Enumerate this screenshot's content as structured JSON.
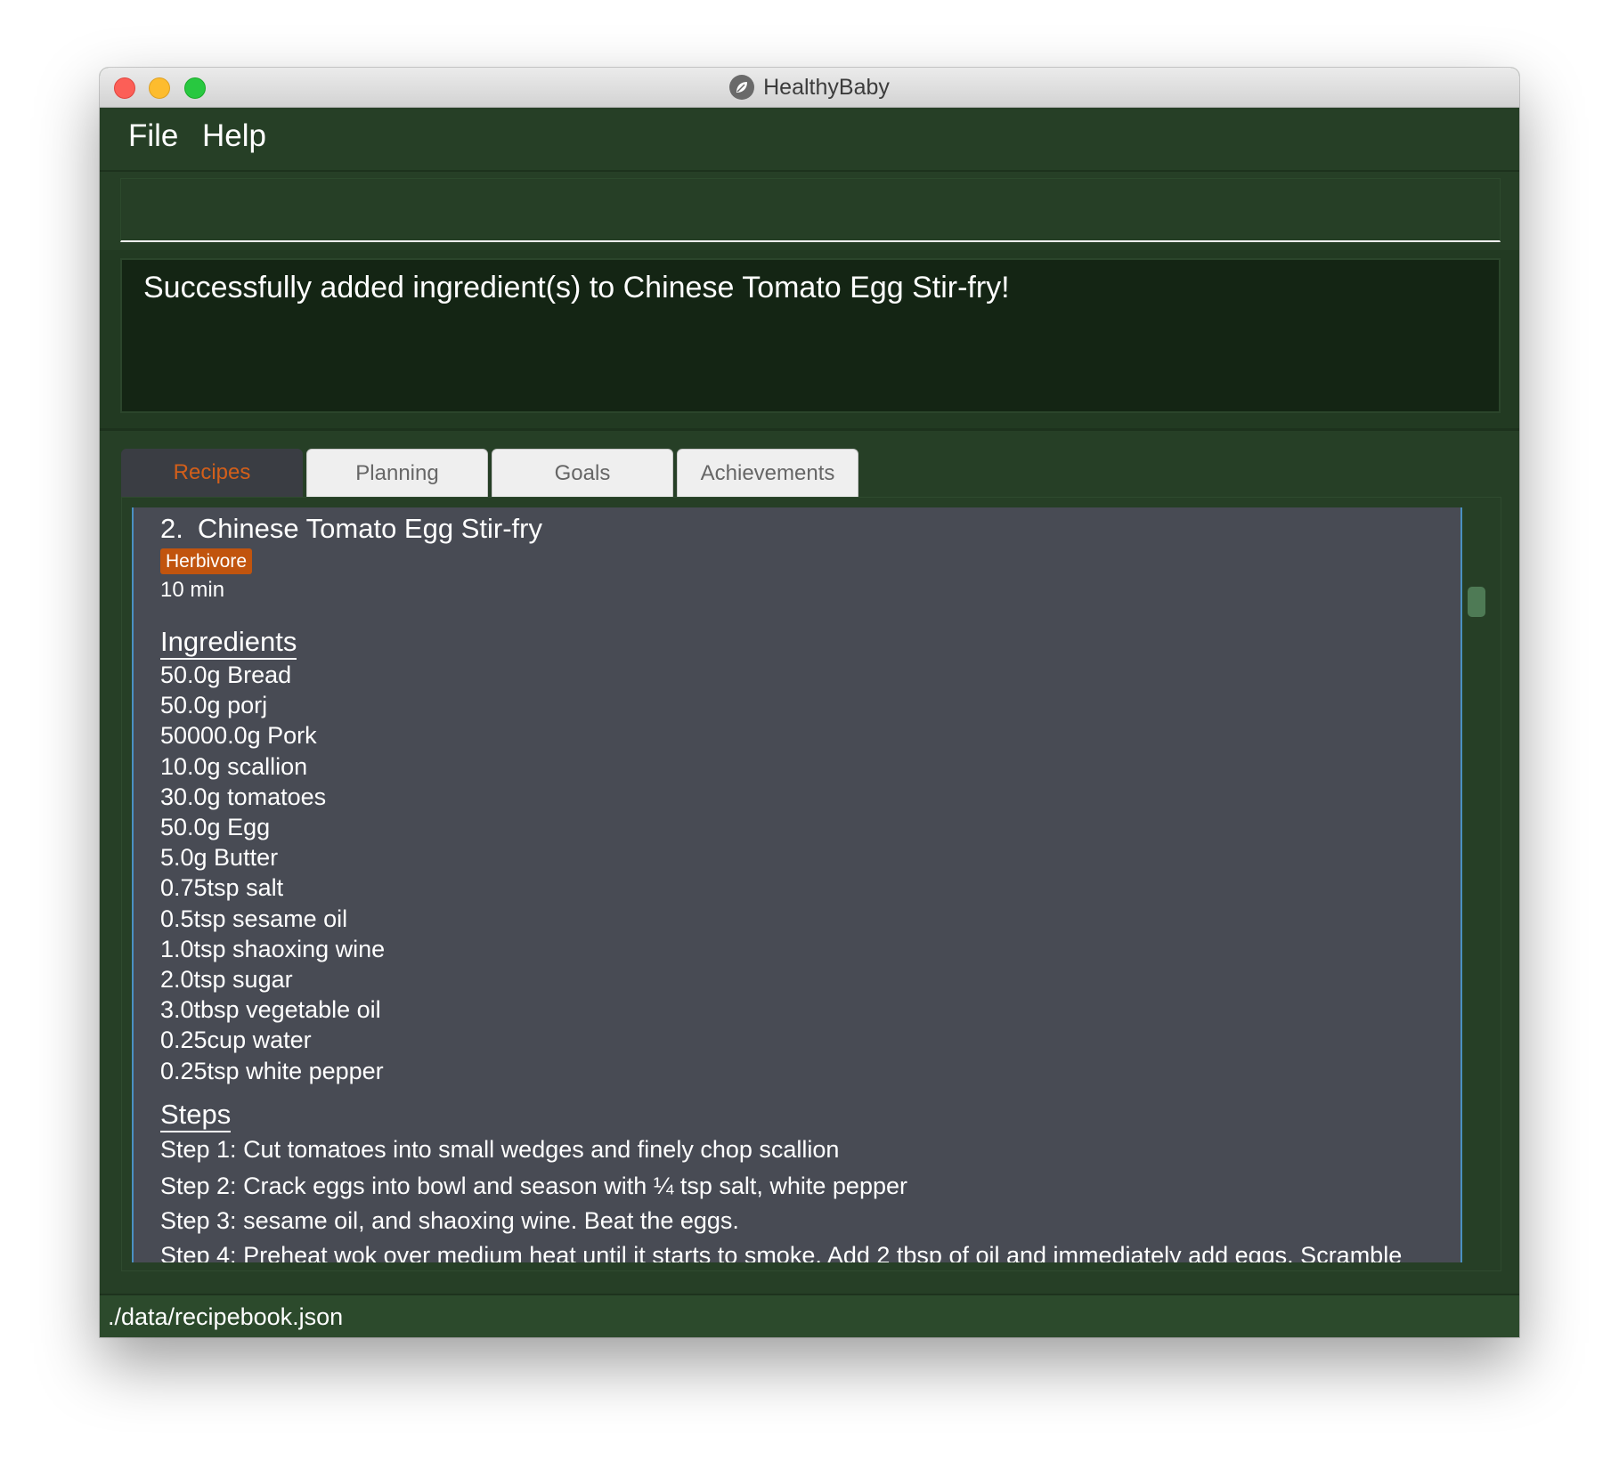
{
  "window": {
    "title": "HealthyBaby",
    "app_icon": "leaf-icon"
  },
  "menu": {
    "items": [
      {
        "label": "File"
      },
      {
        "label": "Help"
      }
    ]
  },
  "command": {
    "value": "",
    "placeholder": ""
  },
  "result": {
    "message": "Successfully added ingredient(s) to Chinese Tomato Egg Stir-fry!"
  },
  "tabs": [
    {
      "label": "Recipes",
      "active": true
    },
    {
      "label": "Planning",
      "active": false
    },
    {
      "label": "Goals",
      "active": false
    },
    {
      "label": "Achievements",
      "active": false
    }
  ],
  "recipe": {
    "index": "2.",
    "name": "Chinese Tomato Egg Stir-fry",
    "tag": "Herbivore",
    "prep_time": "10 min",
    "ingredients_header": "Ingredients",
    "ingredients": [
      "50.0g Bread",
      "50.0g porj",
      "50000.0g Pork",
      "10.0g scallion",
      "30.0g tomatoes",
      "50.0g Egg",
      "5.0g Butter",
      "0.75tsp salt",
      "0.5tsp sesame oil",
      "1.0tsp shaoxing wine",
      "2.0tsp sugar",
      "3.0tbsp vegetable oil",
      "0.25cup water",
      "0.25tsp white pepper"
    ],
    "steps_header": "Steps",
    "steps": [
      "Step 1: Cut tomatoes into small wedges and finely chop scallion",
      "Step 2: Crack eggs into bowl and season with ¼ tsp salt, white pepper",
      "Step 3: sesame oil, and shaoxing wine. Beat the eggs.",
      "Step 4: Preheat wok over medium heat until it starts to smoke. Add 2 tbsp of oil and immediately add eggs. Scramble"
    ]
  },
  "status": {
    "path": "./data/recipebook.json"
  },
  "colors": {
    "background": "#263f26",
    "result_box": "#142514",
    "card": "#484b54",
    "accent": "#c1540e",
    "active_tab_text": "#d35f1a"
  }
}
